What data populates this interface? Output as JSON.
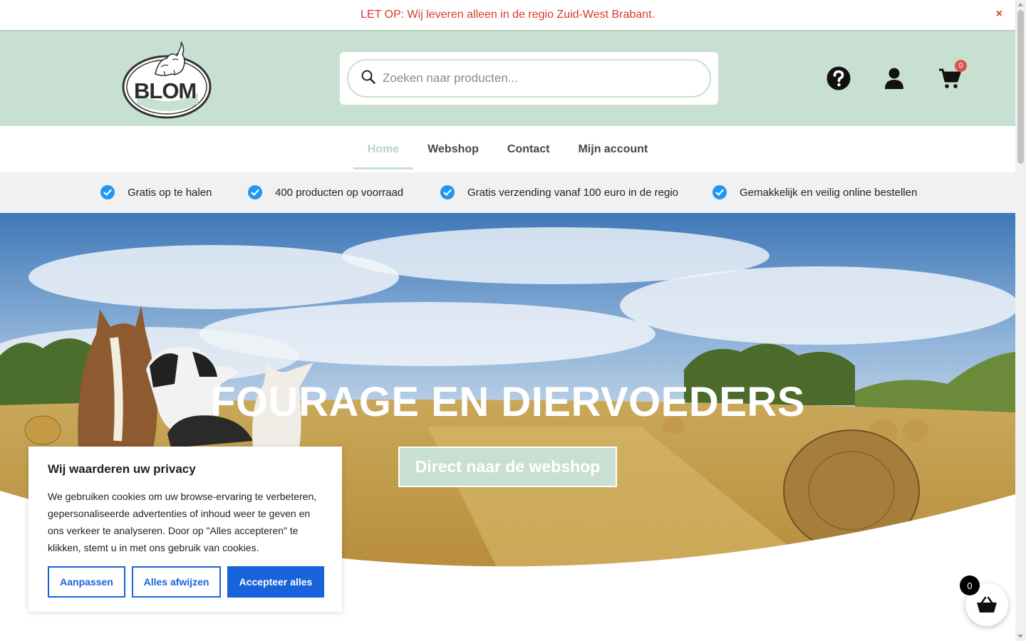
{
  "notice": {
    "text": "LET OP: Wij leveren alleen in de regio Zuid-West Brabant.",
    "close": "×"
  },
  "header": {
    "logo_text": "BLOM",
    "search": {
      "placeholder": "Zoeken naar producten..."
    },
    "cart_count": "0"
  },
  "nav": {
    "items": [
      "Home",
      "Webshop",
      "Contact",
      "Mijn account"
    ],
    "active": "Home"
  },
  "usp": {
    "items": [
      "Gratis op te halen",
      "400 producten op voorraad",
      "Gratis verzending vanaf 100 euro in de regio",
      "Gemakkelijk en veilig online bestellen"
    ]
  },
  "hero": {
    "title": "FOURAGE EN DIERVOEDERS",
    "button": "Direct naar de webshop"
  },
  "cookie": {
    "title": "Wij waarderen uw privacy",
    "text": "We gebruiken cookies om uw browse-ervaring te verbeteren, gepersonaliseerde advertenties of inhoud weer te geven en ons verkeer te analyseren. Door op \"Alles accepteren\" te klikken, stemt u in met ons gebruik van cookies.",
    "buttons": {
      "customize": "Aanpassen",
      "reject": "Alles afwijzen",
      "accept": "Accepteer alles"
    }
  },
  "floating_cart": {
    "count": "0"
  },
  "colors": {
    "brand_green": "#c8e0d2",
    "notice_red": "#d33b2b",
    "cookie_blue": "#1863dc",
    "check_blue": "#2196f3"
  }
}
